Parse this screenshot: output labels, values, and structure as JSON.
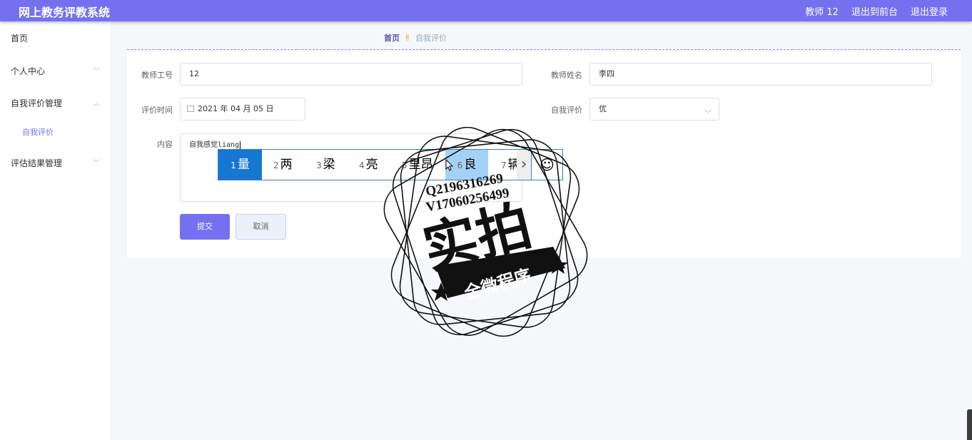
{
  "header": {
    "title": "网上教务评教系统",
    "links": [
      "教师 12",
      "退出到前台",
      "退出登录"
    ]
  },
  "sidebar": {
    "items": [
      {
        "label": "首页"
      },
      {
        "label": "个人中心"
      },
      {
        "label": "自我评价管理"
      },
      {
        "label": "评估结果管理"
      }
    ],
    "sub_items": [
      {
        "label": "自我评价"
      }
    ]
  },
  "breadcrumb": {
    "home": "首页",
    "current": "自我评价"
  },
  "form": {
    "teacher_id": {
      "label": "教师工号",
      "value": "12"
    },
    "teacher_name": {
      "label": "教师姓名",
      "value": "李四"
    },
    "eval_time": {
      "label": "评价时间",
      "value": "2021 年 04 月 05 日"
    },
    "self_eval": {
      "label": "自我评价",
      "value": "优"
    },
    "content": {
      "label": "内容",
      "value": "自我感觉liang"
    },
    "submit_label": "提交",
    "cancel_label": "取消"
  },
  "ime": {
    "candidates": [
      {
        "n": "1",
        "text": "量"
      },
      {
        "n": "2",
        "text": "两"
      },
      {
        "n": "3",
        "text": "梁"
      },
      {
        "n": "4",
        "text": "亮"
      },
      {
        "n": "5",
        "text": "里昂"
      },
      {
        "n": "6",
        "text": "良"
      },
      {
        "n": "7",
        "text": "辆"
      }
    ],
    "emoji": "☺",
    "next": "›"
  },
  "watermark": {
    "lines": [
      "Q2196316269",
      "V17060256499"
    ],
    "main": "实拍",
    "banner": "全微程序"
  },
  "colors": {
    "accent": "#7570f0",
    "ime_selected": "#1677d2",
    "ime_highlight": "#a6d1f7"
  }
}
